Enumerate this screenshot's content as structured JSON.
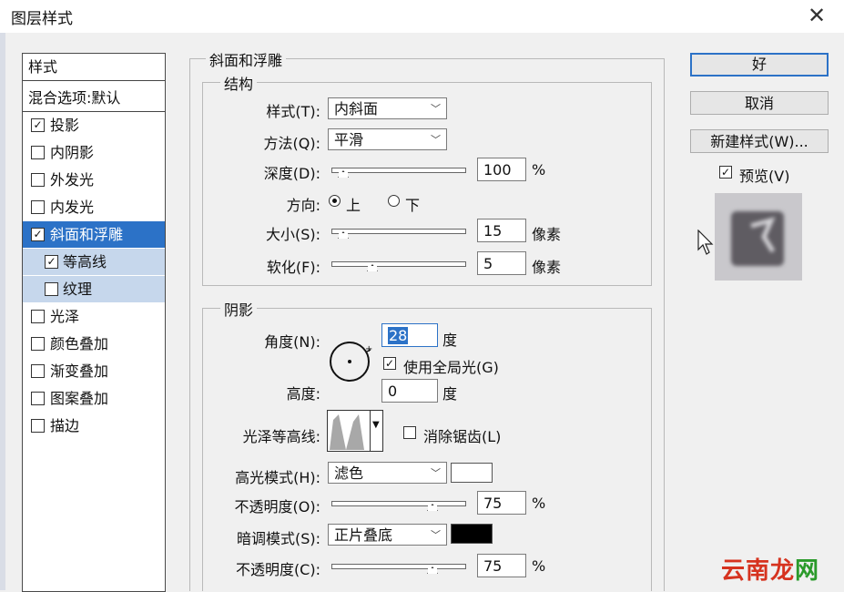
{
  "window": {
    "title": "图层样式"
  },
  "styles_panel": {
    "header": "样式",
    "blend_options": "混合选项:默认",
    "items": [
      {
        "label": "投影",
        "checked": true
      },
      {
        "label": "内阴影",
        "checked": false
      },
      {
        "label": "外发光",
        "checked": false
      },
      {
        "label": "内发光",
        "checked": false
      },
      {
        "label": "斜面和浮雕",
        "checked": true,
        "selected": true
      },
      {
        "label": "等高线",
        "checked": true,
        "sub": true
      },
      {
        "label": "纹理",
        "checked": false,
        "sub": true
      },
      {
        "label": "光泽",
        "checked": false
      },
      {
        "label": "颜色叠加",
        "checked": false
      },
      {
        "label": "渐变叠加",
        "checked": false
      },
      {
        "label": "图案叠加",
        "checked": false
      },
      {
        "label": "描边",
        "checked": false
      }
    ]
  },
  "bevel": {
    "section_title": "斜面和浮雕",
    "structure": {
      "title": "结构",
      "style_label": "样式(T):",
      "style_value": "内斜面",
      "technique_label": "方法(Q):",
      "technique_value": "平滑",
      "depth_label": "深度(D):",
      "depth_value": "100",
      "depth_unit": "%",
      "direction_label": "方向:",
      "dir_up": "上",
      "dir_down": "下",
      "size_label": "大小(S):",
      "size_value": "15",
      "size_unit": "像素",
      "soften_label": "软化(F):",
      "soften_value": "5",
      "soften_unit": "像素"
    },
    "shading": {
      "title": "阴影",
      "angle_label": "角度(N):",
      "angle_value": "28",
      "angle_unit": "度",
      "global_light": "使用全局光(G)",
      "altitude_label": "高度:",
      "altitude_value": "0",
      "altitude_unit": "度",
      "gloss_label": "光泽等高线:",
      "anti_alias": "消除锯齿(L)",
      "highlight_label": "高光模式(H):",
      "highlight_mode": "滤色",
      "highlight_color": "#ffffff",
      "hl_opacity_label": "不透明度(O):",
      "hl_opacity_value": "75",
      "hl_opacity_unit": "%",
      "shadow_label": "暗调模式(S):",
      "shadow_mode": "正片叠底",
      "shadow_color": "#000000",
      "sh_opacity_label": "不透明度(C):",
      "sh_opacity_value": "75",
      "sh_opacity_unit": "%"
    }
  },
  "buttons": {
    "ok": "好",
    "cancel": "取消",
    "new_style": "新建样式(W)...",
    "preview": "预览(V)"
  },
  "watermark": "云南龙网"
}
